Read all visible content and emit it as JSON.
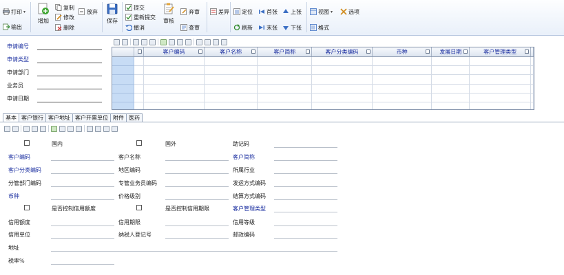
{
  "ribbon": {
    "print": "打印",
    "output": "输出",
    "add": "增加",
    "copy": "复制",
    "modify": "修改",
    "delete": "删除",
    "abandon": "放弃",
    "save": "保存",
    "submit": "提交",
    "resubmit": "重新提交",
    "revoke": "撤消",
    "audit": "审核",
    "unaudit": "弃审",
    "check_audit": "查审",
    "diff": "差异",
    "locate": "定位",
    "refresh": "刷新",
    "first": "首张",
    "last": "末张",
    "prev": "上张",
    "next": "下张",
    "view": "视图",
    "format": "格式",
    "options": "选项"
  },
  "header": {
    "fields": [
      {
        "label": "申请编号",
        "value": ""
      },
      {
        "label": "申请类型",
        "value": ""
      },
      {
        "label": "申请部门",
        "value": ""
      },
      {
        "label": "业务员",
        "value": ""
      },
      {
        "label": "申请日期",
        "value": ""
      }
    ]
  },
  "grid": {
    "columns": [
      "客户编码",
      "客户名称",
      "客户简称",
      "客户分类编码",
      "币种",
      "发展日期",
      "客户管理类型"
    ],
    "row_count": 6
  },
  "tabs": [
    "基本",
    "客户银行",
    "客户地址",
    "客户开票单位",
    "附件",
    "医药"
  ],
  "form": {
    "domestic": "国内",
    "foreign": "国外",
    "mnemonic": "助记码",
    "customer_code": "客户编码",
    "customer_name": "客户名称",
    "customer_short": "客户简称",
    "customer_class": "客户分类编码",
    "region_code": "地区编码",
    "industry": "所属行业",
    "dept_code": "分管部门编码",
    "salesman_code": "专管业务员编码",
    "shipping_code": "发运方式编码",
    "currency": "币种",
    "price_level": "价格级别",
    "settlement_code": "结算方式编码",
    "control_credit_limit": "是否控制信用额度",
    "control_credit_period": "是否控制信用期限",
    "customer_mgmt_type": "客户管理类型",
    "credit_limit": "信用额度",
    "credit_period": "信用期限",
    "credit_level": "信用等级",
    "credit_unit": "信用单位",
    "taxpayer_id": "纳税人登记号",
    "postcode": "邮政编码",
    "address": "地址",
    "tax_rate": "税率%"
  }
}
